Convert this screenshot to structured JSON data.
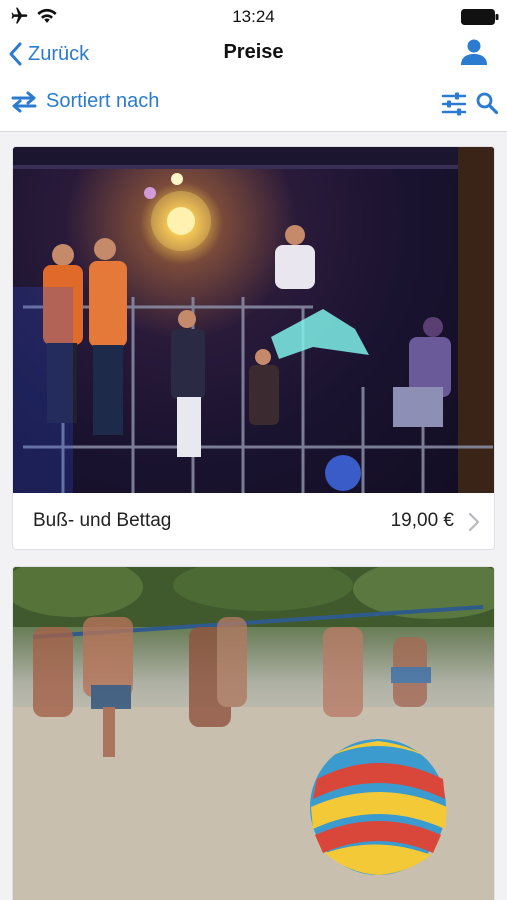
{
  "status_bar": {
    "time": "13:24",
    "airplane_icon": "airplane-icon",
    "wifi_icon": "wifi-icon",
    "battery_icon": "battery-icon"
  },
  "nav": {
    "back_label": "Zurück",
    "title": "Preise",
    "user_icon": "user-icon"
  },
  "toolbar": {
    "sort_label": "Sortiert nach",
    "sort_icon": "swap-arrows-icon",
    "filter_icon": "sliders-icon",
    "search_icon": "search-icon"
  },
  "colors": {
    "accent": "#2b7bd1",
    "background": "#f2f2f4",
    "card": "#ffffff"
  },
  "items": [
    {
      "title": "Buß- und Bettag",
      "price": "19,00 €"
    },
    {
      "title": "",
      "price": ""
    }
  ]
}
